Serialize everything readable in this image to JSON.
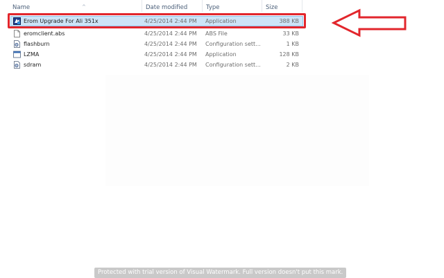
{
  "columns": {
    "name": "Name",
    "date_modified": "Date modified",
    "type": "Type",
    "size": "Size"
  },
  "sort_indicator": "^",
  "files": [
    {
      "name": "Erom Upgrade For Ali 351x",
      "date": "4/25/2014 2:44 PM",
      "type": "Application",
      "size": "388 KB",
      "icon": "application-icon",
      "selected": true
    },
    {
      "name": "eromclient.abs",
      "date": "4/25/2014 2:44 PM",
      "type": "ABS File",
      "size": "33 KB",
      "icon": "blank-file-icon",
      "selected": false
    },
    {
      "name": "flashburn",
      "date": "4/25/2014 2:44 PM",
      "type": "Configuration sett...",
      "size": "1 KB",
      "icon": "config-file-icon",
      "selected": false
    },
    {
      "name": "LZMA",
      "date": "4/25/2014 2:44 PM",
      "type": "Application",
      "size": "128 KB",
      "icon": "application-icon",
      "selected": false
    },
    {
      "name": "sdram",
      "date": "4/25/2014 2:44 PM",
      "type": "Configuration sett...",
      "size": "2 KB",
      "icon": "config-file-icon",
      "selected": false
    }
  ],
  "annotation": {
    "highlight_color": "#e2262c",
    "arrow_color": "#e2262c",
    "arrow_direction": "left"
  },
  "watermark": "Protected with trial version of Visual Watermark. Full version doesn't put this mark."
}
